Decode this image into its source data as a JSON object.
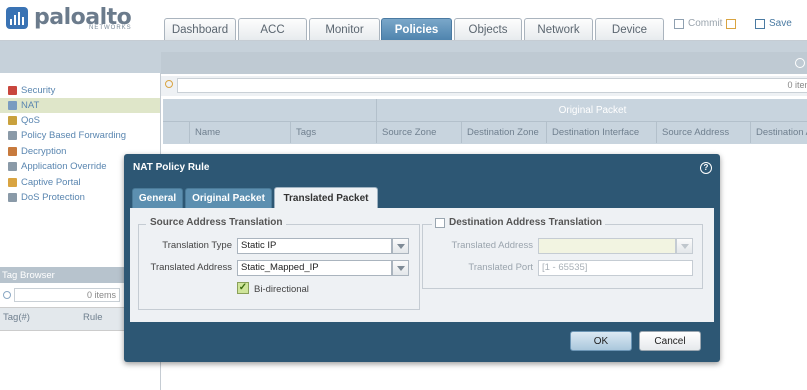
{
  "brand": {
    "name": "paloalto",
    "sub": "NETWORKS"
  },
  "tabs": [
    {
      "label": "Dashboard"
    },
    {
      "label": "ACC"
    },
    {
      "label": "Monitor"
    },
    {
      "label": "Policies"
    },
    {
      "label": "Objects"
    },
    {
      "label": "Network"
    },
    {
      "label": "Device"
    }
  ],
  "header_actions": {
    "commit": "Commit",
    "save": "Save"
  },
  "nav": [
    {
      "label": "Security",
      "icon": "security-icon"
    },
    {
      "label": "NAT",
      "icon": "nat-icon"
    },
    {
      "label": "QoS",
      "icon": "qos-icon"
    },
    {
      "label": "Policy Based Forwarding",
      "icon": "pbf-icon"
    },
    {
      "label": "Decryption",
      "icon": "decryption-icon"
    },
    {
      "label": "Application Override",
      "icon": "app-override-icon"
    },
    {
      "label": "Captive Portal",
      "icon": "captive-portal-icon"
    },
    {
      "label": "DoS Protection",
      "icon": "dos-icon"
    }
  ],
  "tag_browser": {
    "title": "Tag Browser",
    "count": "0 items",
    "col1": "Tag(#)",
    "col2": "Rule"
  },
  "grid": {
    "items": "0 item",
    "group": "Original Packet",
    "columns": [
      "Name",
      "Tags",
      "Source Zone",
      "Destination Zone",
      "Destination Interface",
      "Source Address",
      "Destination A"
    ]
  },
  "dialog": {
    "title": "NAT Policy Rule",
    "tabs": [
      "General",
      "Original Packet",
      "Translated Packet"
    ],
    "source": {
      "legend": "Source Address Translation",
      "type_label": "Translation Type",
      "type_value": "Static IP",
      "addr_label": "Translated Address",
      "addr_value": "Static_Mapped_IP",
      "bidir_label": "Bi-directional"
    },
    "dest": {
      "legend": "Destination Address Translation",
      "addr_label": "Translated Address",
      "port_label": "Translated Port",
      "port_placeholder": "[1 - 65535]"
    },
    "ok": "OK",
    "cancel": "Cancel"
  },
  "colors": {
    "accent": "#4f84ae",
    "dialog": "#2d5774",
    "nav_selected": "#dfe6c9"
  }
}
